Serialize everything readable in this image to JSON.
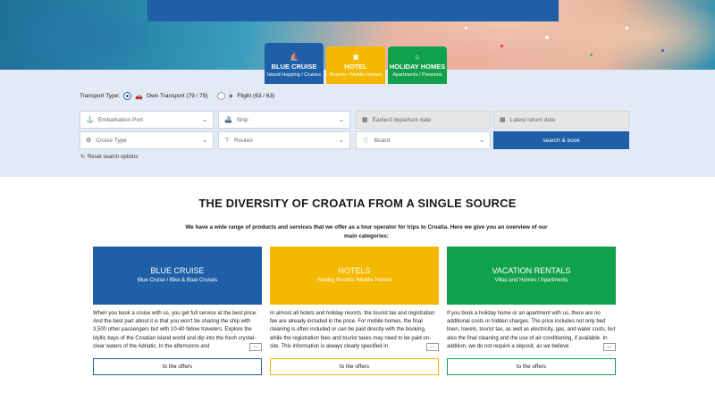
{
  "tabs": [
    {
      "title": "BLUE CRUISE",
      "subtitle": "Island Hopping / Cruises",
      "icon": "ship-icon"
    },
    {
      "title": "HOTEL",
      "subtitle": "Resorts / Mobile Homes",
      "icon": "hotel-icon"
    },
    {
      "title": "HOLIDAY HOMES",
      "subtitle": "Apartments / Pensions",
      "icon": "house-icon"
    }
  ],
  "search": {
    "transport_label": "Transport Type:",
    "own_transport": "Own Transport (79 / 79)",
    "flight": "Flight (63 / 63)",
    "embarkation_port": "Embarkation Port",
    "ship": "Ship",
    "earliest_departure": "Earliest departure date",
    "latest_return": "Latest return date",
    "cruise_type": "Cruise Type",
    "routes": "Routes",
    "board": "Board",
    "search_button": "search & book",
    "reset": "Reset search options"
  },
  "content": {
    "headline": "THE DIVERSITY OF CROATIA FROM A SINGLE SOURCE",
    "intro": "We have a wide range of products and services that we offer as a tour operator for trips to Croatia. Here we give you an overview of our main categories:"
  },
  "cards": [
    {
      "title": "BLUE CRUISE",
      "subtitle": "Blue Cruise / Bike & Boat Cruises",
      "text": "When you book a cruise with us, you get full service at the best price. And the best part about it is that you won't be sharing the ship with 3,500 other passengers but with 10-40 fellow travelers. Explore the idyllic bays of the Croatian island world and dip into the fresh crystal-clear waters of the Adriatic. In the afternoons and",
      "more": "...",
      "button": "to the offers",
      "color": "#1e5fa8"
    },
    {
      "title": "HOTELS",
      "subtitle": "Holiday Resorts /Mobile Homes",
      "text": "In almost all hotels and holiday resorts, the tourist tax and registration fee are already included in the price. For mobile homes, the final cleaning is often included or can be paid directly with the booking, while the registration fees and tourist taxes may need to be paid on-site. This information is always clearly specified in",
      "more": "...",
      "button": "to the offers",
      "color": "#f5b800"
    },
    {
      "title": "VACATION RENTALS",
      "subtitle": "Villas and Homes / Apartments",
      "text": "If you book a holiday home or an apartment with us, there are no additional costs or hidden charges. The price includes not only bed linen, towels, tourist tax, as well as electricity, gas, and water costs, but also the final cleaning and the use of air conditioning, if available. In addition, we do not require a deposit, as we believe",
      "more": "...",
      "button": "to the offers",
      "color": "#12a14b"
    }
  ]
}
